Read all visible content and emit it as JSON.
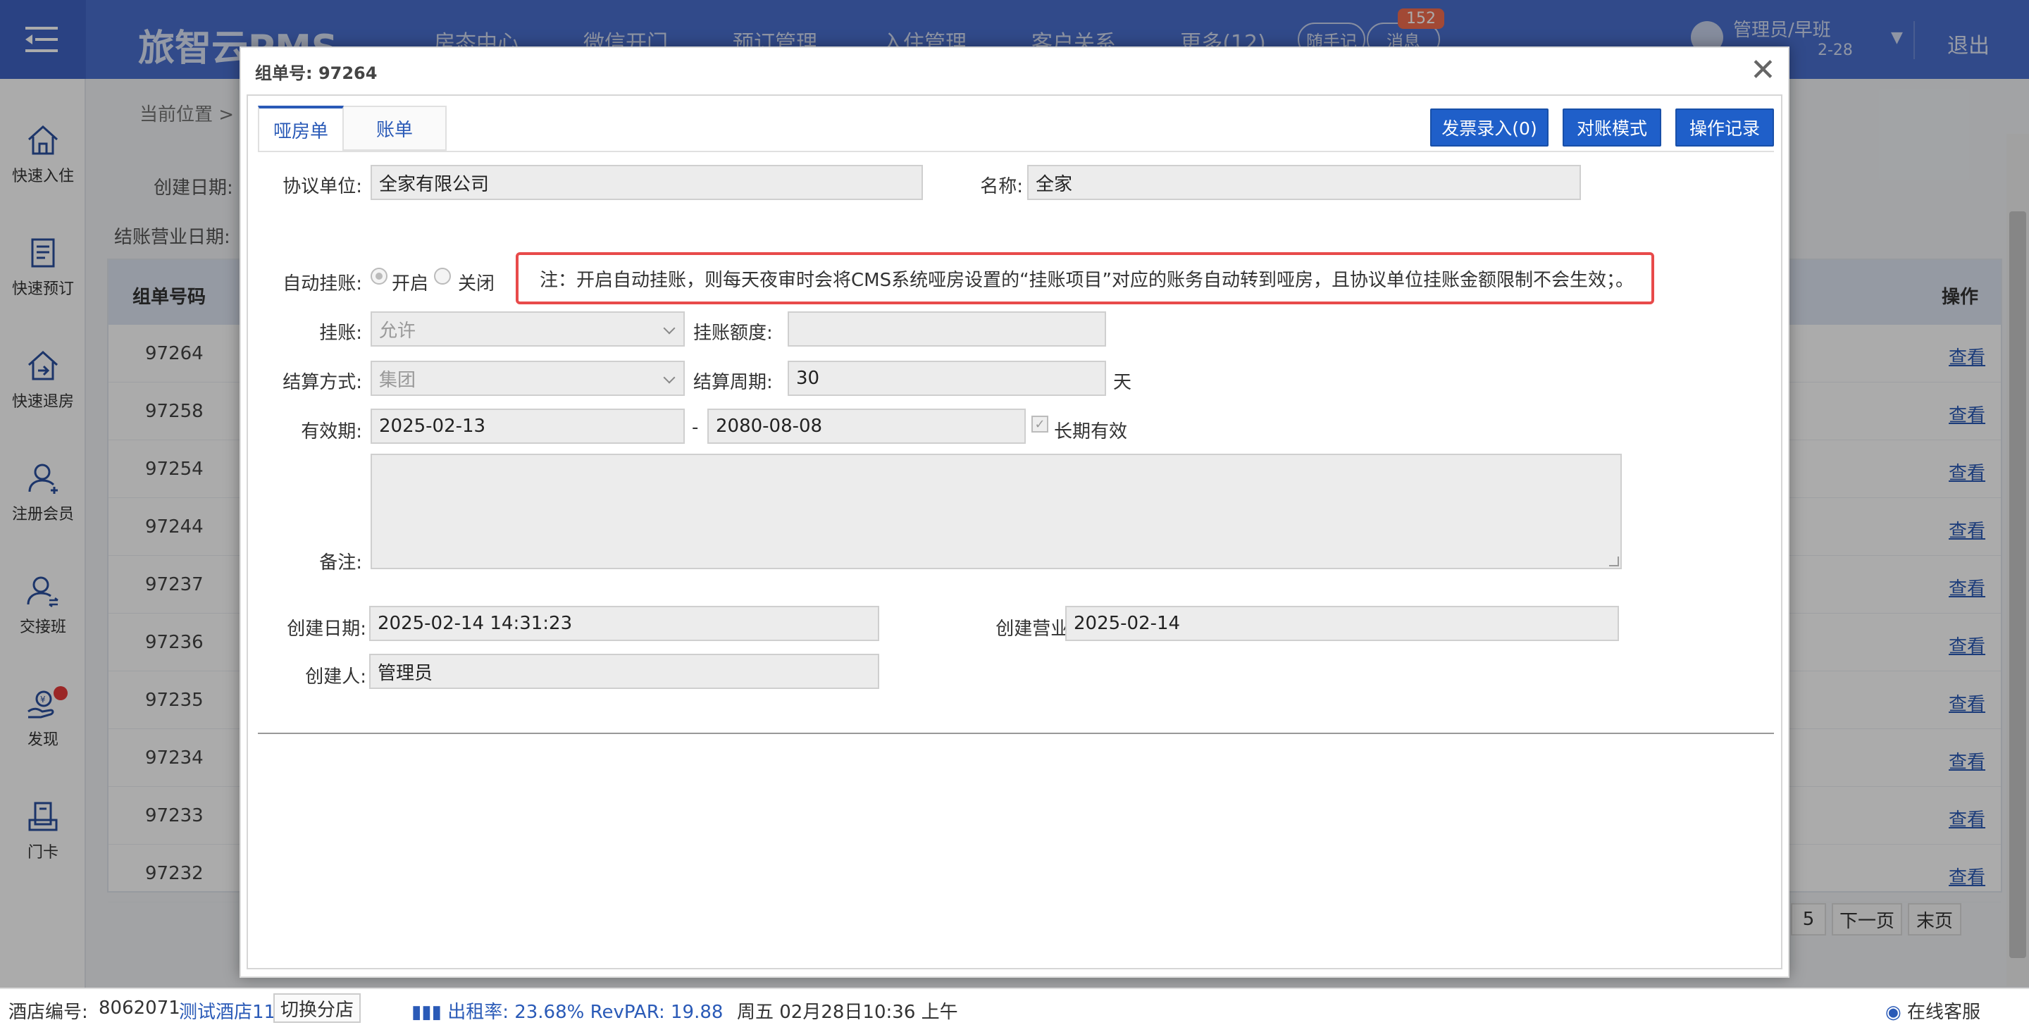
{
  "header": {
    "logo": "旅智云PMS",
    "nav": [
      "房态中心",
      "微信开门",
      "预订管理",
      "入住管理",
      "客户关系",
      "更多(12)"
    ],
    "notes_button": "随手记",
    "messages_button": "消息",
    "messages_badge": "152",
    "user_name": "管理员/早班",
    "user_date": "2-28",
    "logout": "退出"
  },
  "sidebar": {
    "items": [
      {
        "label": "快速入住",
        "icon": "home-icon"
      },
      {
        "label": "快速预订",
        "icon": "booking-icon"
      },
      {
        "label": "快速退房",
        "icon": "checkout-icon"
      },
      {
        "label": "注册会员",
        "icon": "add-member-icon"
      },
      {
        "label": "交接班",
        "icon": "shift-icon"
      },
      {
        "label": "发现",
        "icon": "discover-icon"
      },
      {
        "label": "门卡",
        "icon": "card-icon"
      }
    ]
  },
  "background": {
    "breadcrumb": "当前位置 >",
    "created_date_label": "创建日期:",
    "closing_date_label": "结账营业日期:",
    "table_header_id": "组单号码",
    "table_header_op": "操作",
    "rows": [
      "97264",
      "97258",
      "97254",
      "97244",
      "97237",
      "97236",
      "97235",
      "97234",
      "97233",
      "97232"
    ],
    "row_action": "查看",
    "pager": {
      "page": "5",
      "next": "下一页",
      "last": "末页"
    }
  },
  "modal": {
    "title": "组单号: 97264",
    "close": "✕",
    "tabs": [
      "哑房单",
      "账单"
    ],
    "buttons": {
      "invoice": "发票录入(0)",
      "reconcile": "对账模式",
      "log": "操作记录"
    },
    "fields": {
      "agreement_label": "协议单位:",
      "agreement_value": "全家有限公司",
      "name_label": "名称:",
      "name_value": "全家",
      "auto_charge_label": "自动挂账:",
      "auto_on": "开启",
      "auto_off": "关闭",
      "note": "注：开启自动挂账，则每天夜审时会将CMS系统哑房设置的“挂账项目”对应的账务自动转到哑房，且协议单位挂账金额限制不会生效；。",
      "charge_label": "挂账:",
      "charge_value": "允许",
      "limit_label": "挂账额度:",
      "limit_value": "",
      "settle_label": "结算方式:",
      "settle_value": "集团",
      "period_label": "结算周期:",
      "period_value": "30",
      "period_unit": "天",
      "valid_label": "有效期:",
      "valid_from": "2025-02-13",
      "valid_sep": "-",
      "valid_to": "2080-08-08",
      "long_term": "长期有效",
      "remark_label": "备注:",
      "created_label": "创建日期:",
      "created_value": "2025-02-14 14:31:23",
      "created_biz_label": "创建营业日期:",
      "created_biz_value": "2025-02-14",
      "creator_label": "创建人:",
      "creator_value": "管理员"
    }
  },
  "footer": {
    "hotel_no_label": "酒店编号:",
    "hotel_no": "8062071",
    "hotel_name": "测试酒店11",
    "switch_branch": "切换分店",
    "occupancy": "出租率: 23.68% RevPAR: 19.88",
    "datetime": "周五 02月28日10:36 上午",
    "online_service": "在线客服"
  },
  "colors": {
    "primary": "#4a6fce",
    "button": "#1f5fc9",
    "note_border": "#e84a4a",
    "link": "#2a5ab7"
  }
}
